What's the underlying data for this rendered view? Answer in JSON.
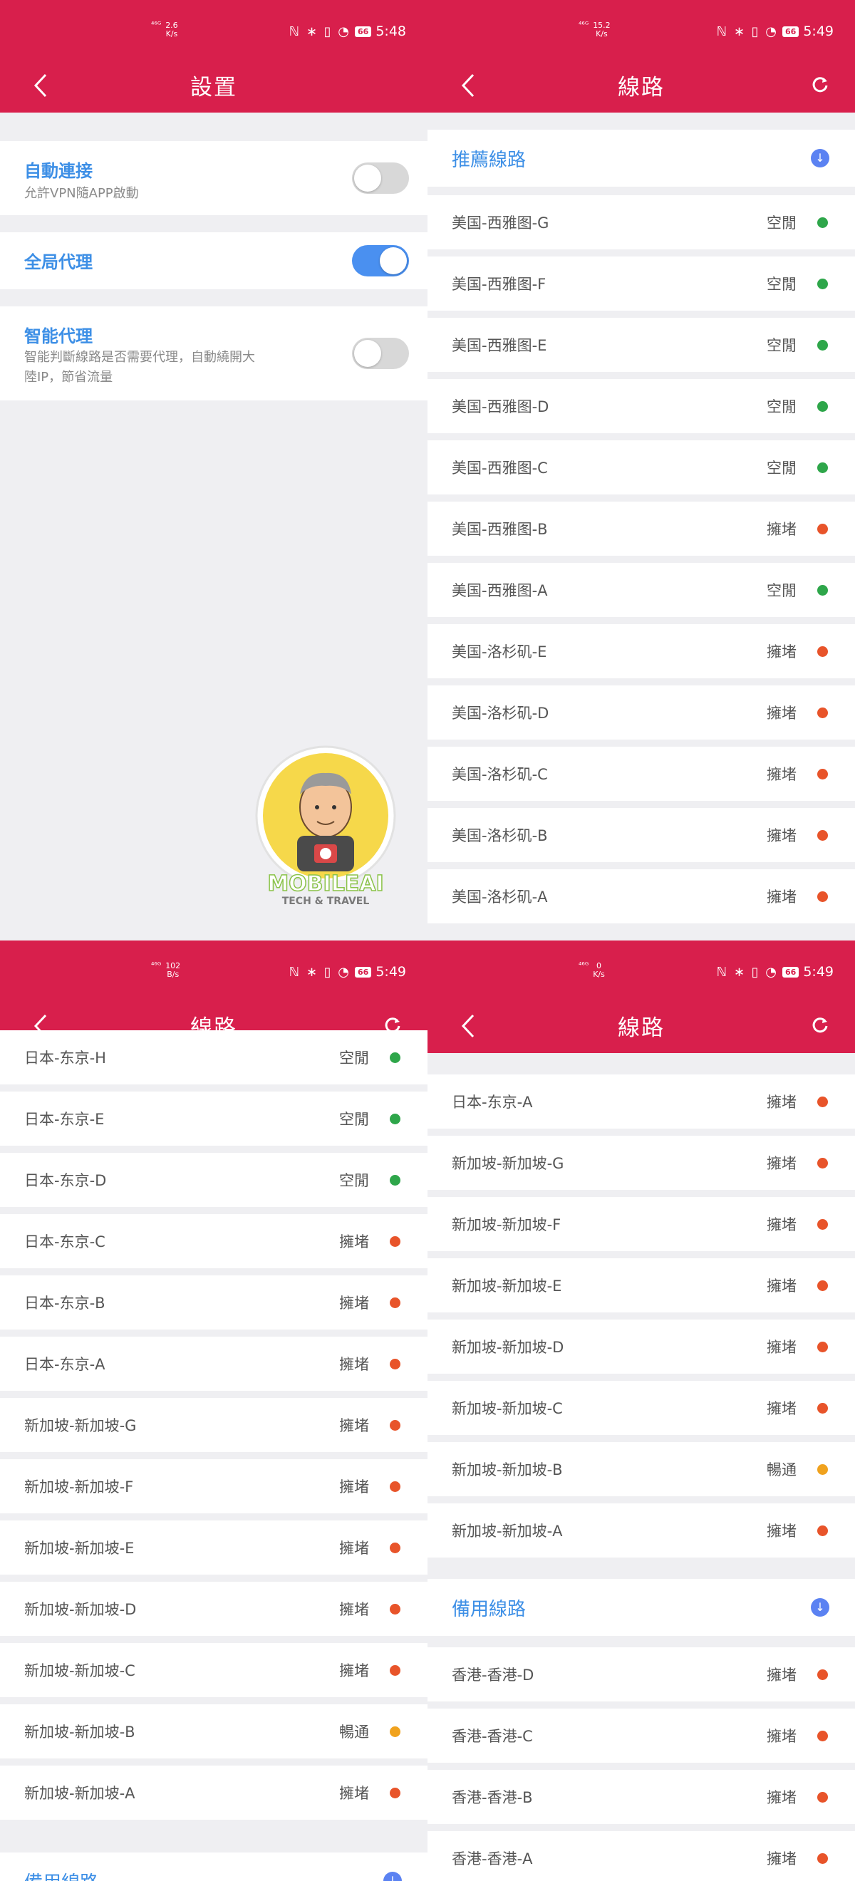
{
  "colors": {
    "header": "#d81f4c",
    "accent_blue": "#3d8fe6",
    "dot_idle": "#2ea64a",
    "dot_congested": "#e8542a",
    "dot_smooth": "#f0a21e",
    "toggle_on": "#4a90f0"
  },
  "panels": [
    {
      "status": {
        "signal": "⁴⁶ᴳ",
        "net_speed": "2.6",
        "net_unit": "K/s",
        "battery": "66",
        "time": "5:48"
      },
      "title": "設置",
      "settings": [
        {
          "title": "自動連接",
          "desc": "允許VPN隨APP啟動",
          "on": false
        },
        {
          "title": "全局代理",
          "desc": "",
          "on": true
        },
        {
          "title": "智能代理",
          "desc": "智能判斷線路是否需要代理，自動繞開大陸IP，節省流量",
          "on": false
        }
      ],
      "watermark": {
        "brand": "MOBILEAI",
        "tagline": "TECH & TRAVEL"
      }
    },
    {
      "status": {
        "signal": "⁴⁶ᴳ",
        "net_speed": "15.2",
        "net_unit": "K/s",
        "battery": "66",
        "time": "5:49"
      },
      "title": "線路",
      "section": "推薦線路",
      "servers": [
        {
          "name": "美国-西雅图-G",
          "status": "空閒",
          "dot": "idle"
        },
        {
          "name": "美国-西雅图-F",
          "status": "空閒",
          "dot": "idle"
        },
        {
          "name": "美国-西雅图-E",
          "status": "空閒",
          "dot": "idle"
        },
        {
          "name": "美国-西雅图-D",
          "status": "空閒",
          "dot": "idle"
        },
        {
          "name": "美国-西雅图-C",
          "status": "空閒",
          "dot": "idle"
        },
        {
          "name": "美国-西雅图-B",
          "status": "擁堵",
          "dot": "congested"
        },
        {
          "name": "美国-西雅图-A",
          "status": "空閒",
          "dot": "idle"
        },
        {
          "name": "美国-洛杉矶-E",
          "status": "擁堵",
          "dot": "congested"
        },
        {
          "name": "美国-洛杉矶-D",
          "status": "擁堵",
          "dot": "congested"
        },
        {
          "name": "美国-洛杉矶-C",
          "status": "擁堵",
          "dot": "congested"
        },
        {
          "name": "美国-洛杉矶-B",
          "status": "擁堵",
          "dot": "congested"
        },
        {
          "name": "美国-洛杉矶-A",
          "status": "擁堵",
          "dot": "congested"
        }
      ]
    },
    {
      "status": {
        "signal": "⁴⁶ᴳ",
        "net_speed": "102",
        "net_unit": "B/s",
        "battery": "66",
        "time": "5:49"
      },
      "title": "線路",
      "servers": [
        {
          "name": "日本-东京-H",
          "status": "空閒",
          "dot": "idle"
        },
        {
          "name": "日本-东京-E",
          "status": "空閒",
          "dot": "idle"
        },
        {
          "name": "日本-东京-D",
          "status": "空閒",
          "dot": "idle"
        },
        {
          "name": "日本-东京-C",
          "status": "擁堵",
          "dot": "congested"
        },
        {
          "name": "日本-东京-B",
          "status": "擁堵",
          "dot": "congested"
        },
        {
          "name": "日本-东京-A",
          "status": "擁堵",
          "dot": "congested"
        },
        {
          "name": "新加坡-新加坡-G",
          "status": "擁堵",
          "dot": "congested"
        },
        {
          "name": "新加坡-新加坡-F",
          "status": "擁堵",
          "dot": "congested"
        },
        {
          "name": "新加坡-新加坡-E",
          "status": "擁堵",
          "dot": "congested"
        },
        {
          "name": "新加坡-新加坡-D",
          "status": "擁堵",
          "dot": "congested"
        },
        {
          "name": "新加坡-新加坡-C",
          "status": "擁堵",
          "dot": "congested"
        },
        {
          "name": "新加坡-新加坡-B",
          "status": "暢通",
          "dot": "smooth"
        },
        {
          "name": "新加坡-新加坡-A",
          "status": "擁堵",
          "dot": "congested"
        }
      ],
      "section_after": "備用線路"
    },
    {
      "status": {
        "signal": "⁴⁶ᴳ",
        "net_speed": "0",
        "net_unit": "K/s",
        "battery": "66",
        "time": "5:49"
      },
      "title": "線路",
      "servers": [
        {
          "name": "日本-东京-A",
          "status": "擁堵",
          "dot": "congested"
        },
        {
          "name": "新加坡-新加坡-G",
          "status": "擁堵",
          "dot": "congested"
        },
        {
          "name": "新加坡-新加坡-F",
          "status": "擁堵",
          "dot": "congested"
        },
        {
          "name": "新加坡-新加坡-E",
          "status": "擁堵",
          "dot": "congested"
        },
        {
          "name": "新加坡-新加坡-D",
          "status": "擁堵",
          "dot": "congested"
        },
        {
          "name": "新加坡-新加坡-C",
          "status": "擁堵",
          "dot": "congested"
        },
        {
          "name": "新加坡-新加坡-B",
          "status": "暢通",
          "dot": "smooth"
        },
        {
          "name": "新加坡-新加坡-A",
          "status": "擁堵",
          "dot": "congested"
        }
      ],
      "section": "備用線路",
      "backup_servers": [
        {
          "name": "香港-香港-D",
          "status": "擁堵",
          "dot": "congested"
        },
        {
          "name": "香港-香港-C",
          "status": "擁堵",
          "dot": "congested"
        },
        {
          "name": "香港-香港-B",
          "status": "擁堵",
          "dot": "congested"
        },
        {
          "name": "香港-香港-A",
          "status": "擁堵",
          "dot": "congested"
        }
      ]
    }
  ]
}
